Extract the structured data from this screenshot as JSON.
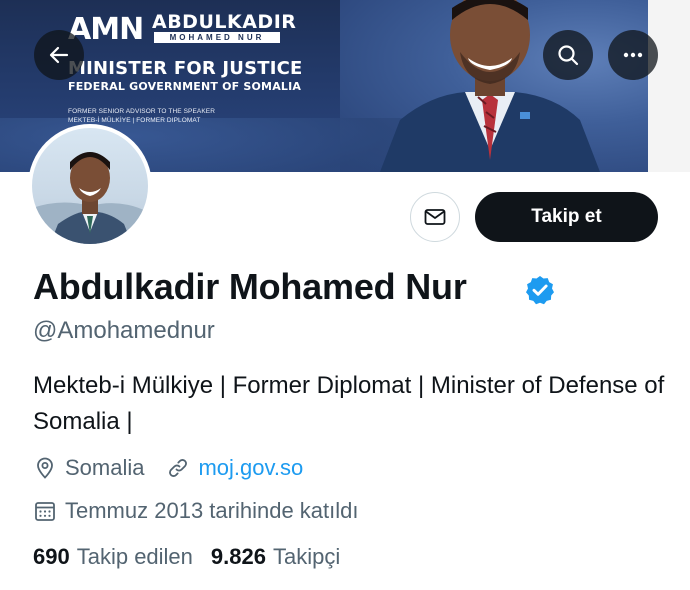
{
  "banner": {
    "logo_mark": "AMN",
    "logo_name": "ABDULKADIR",
    "logo_sub": "MOHAMED NUR",
    "title": "MINISTER FOR JUSTICE",
    "subtitle": "FEDERAL GOVERNMENT OF SOMALIA",
    "small_line_1": "FORMER SENIOR ADVISOR TO THE SPEAKER",
    "small_line_2": "MEKTEB-İ MÜLKİYE | FORMER DIPLOMAT"
  },
  "header": {
    "back_icon": "arrow-left-icon",
    "search_icon": "search-icon",
    "more_icon": "more-horizontal-icon"
  },
  "actions": {
    "message_icon": "envelope-icon",
    "follow_label": "Takip et"
  },
  "profile": {
    "display_name": "Abdulkadir Mohamed Nur",
    "verified_icon": "verified-badge-icon",
    "handle": "@Amohamednur",
    "bio": "Mekteb-i Mülkiye | Former Diplomat | Minister of Defense of Somalia |",
    "location": "Somalia",
    "website": "moj.gov.so",
    "joined": "Temmuz 2013 tarihinde katıldı"
  },
  "stats": {
    "following_count": "690",
    "following_label": "Takip edilen",
    "followers_count": "9.826",
    "followers_label": "Takipçi"
  },
  "colors": {
    "accent": "#1d9bf0",
    "text_primary": "#0f1419",
    "text_secondary": "#536471",
    "banner_navy": "#1d2f55",
    "follow_button_bg": "#0f1419"
  }
}
